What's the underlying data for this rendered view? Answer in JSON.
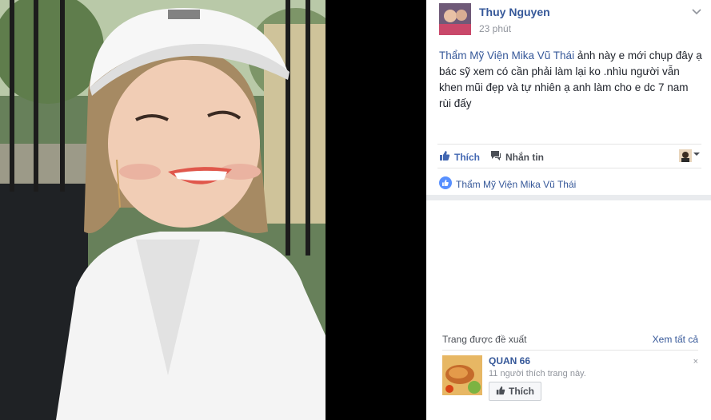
{
  "post": {
    "author": "Thuy Nguyen",
    "time": "23 phút",
    "mention": "Thẩm Mỹ Viện Mika Vũ Thái",
    "text": " ảnh này e mới chụp đây ạ bác sỹ xem có cần phải làm lại ko .nhìu người vẫn khen mũi đẹp và tự nhiên ạ anh làm cho e dc 7 nam rùi đấy"
  },
  "actions": {
    "like_label": "Thích",
    "message_label": "Nhắn tin"
  },
  "likers": {
    "name": "Thẩm Mỹ Viện Mika Vũ Thái"
  },
  "suggested": {
    "title": "Trang được đề xuất",
    "see_all": "Xem tất cả",
    "page": {
      "name": "QUAN 66",
      "likes_text": "11 người thích trang này.",
      "like_button": "Thích",
      "dismiss": "×"
    }
  },
  "icons": {
    "like": "thumbs-up-icon",
    "message": "chat-bubble-icon",
    "chevron": "chevron-down-icon",
    "like_badge": "like-badge-icon"
  },
  "colors": {
    "link": "#365899",
    "accent": "#4267b2",
    "muted": "#90949c",
    "text": "#1d2129",
    "band": "#e9ebee"
  }
}
